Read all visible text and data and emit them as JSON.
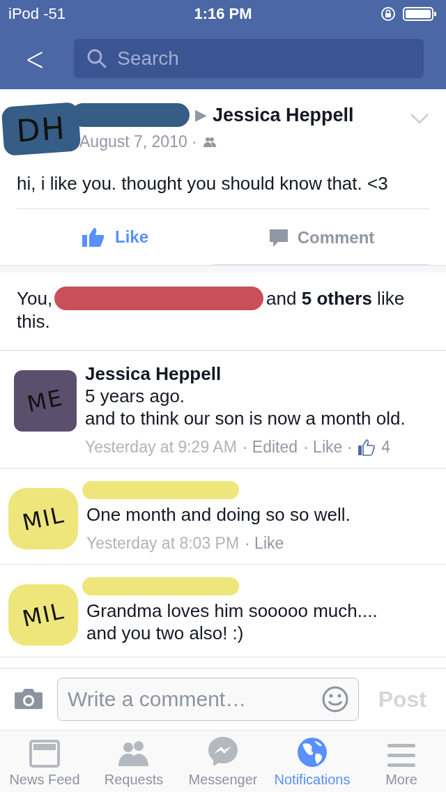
{
  "status_bar": {
    "carrier": "iPod -51",
    "time": "1:16 PM"
  },
  "nav": {
    "back": "<",
    "search_placeholder": "Search"
  },
  "post": {
    "avatar_label": "DH",
    "arrow": "▶",
    "target": "Jessica Heppell",
    "date": "August 7, 2010 ·",
    "text": "hi, i like you. thought you should know that. <3"
  },
  "actions": [
    {
      "kind": "like",
      "label": "Like"
    },
    {
      "kind": "comment",
      "label": "Comment"
    }
  ],
  "likes": {
    "lead": "You,",
    "rest": "and **5 others** like",
    "tail": "this."
  },
  "comments": [
    {
      "kind": "named",
      "avatar_label": "ME",
      "name": "Jessica Heppell",
      "text": "5 years ago.\nand to think our son is now a month old.",
      "meta": [
        "Yesterday at 9:29 AM",
        "· Edited",
        "· Like ·"
      ],
      "like_count": "4"
    },
    {
      "kind": "redacted",
      "avatar_label": "MIL",
      "text": "One month and doing so so well.",
      "meta": [
        "Yesterday at 8:03 PM",
        "· Like"
      ]
    },
    {
      "kind": "redacted",
      "avatar_label": "MIL",
      "text": "Grandma loves him sooooo much....\nand you two also! :)"
    }
  ],
  "composer": {
    "placeholder": "Write a comment…",
    "post": "Post"
  },
  "tabs": [
    {
      "kind": "feed",
      "label": "News Feed",
      "selected": false
    },
    {
      "kind": "requests",
      "label": "Requests",
      "selected": false
    },
    {
      "kind": "messenger",
      "label": "Messenger",
      "selected": false
    },
    {
      "kind": "globe",
      "label": "Notifications",
      "selected": true
    },
    {
      "kind": "more",
      "label": "More",
      "selected": false
    }
  ]
}
